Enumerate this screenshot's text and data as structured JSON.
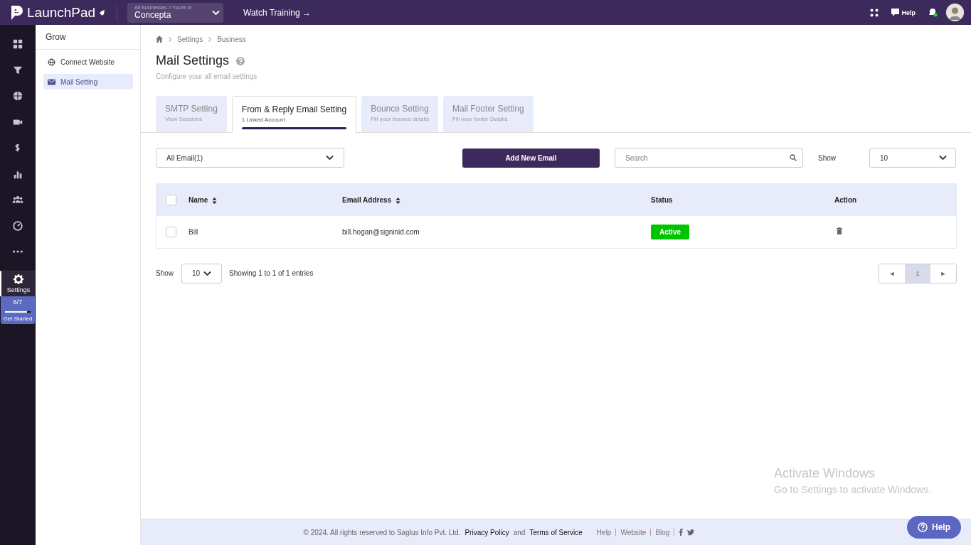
{
  "topbar": {
    "logo": "LaunchPad",
    "business_switcher": {
      "caption": "All Businesses > You're In",
      "value": "Concepta"
    },
    "watch_training": "Watch Training →",
    "help": "Help"
  },
  "rail": {
    "items": [
      {
        "kind": "grid",
        "selected": false
      },
      {
        "kind": "funnel",
        "selected": false
      },
      {
        "kind": "globe",
        "selected": false
      },
      {
        "kind": "video",
        "selected": false
      },
      {
        "kind": "dollar",
        "selected": false
      },
      {
        "kind": "chart",
        "selected": false
      },
      {
        "kind": "people",
        "selected": false
      },
      {
        "kind": "gauge",
        "selected": false
      },
      {
        "kind": "dots",
        "selected": false
      },
      {
        "kind": "gear",
        "label": "Settings",
        "selected": true
      }
    ],
    "progress": {
      "count": "6/7",
      "level": 0.86,
      "label": "Get Started"
    }
  },
  "sidebar": {
    "title": "Grow",
    "items": [
      {
        "label": "Connect Website",
        "kind": "globe",
        "selected": false
      },
      {
        "label": "Mail Setting",
        "kind": "mail",
        "selected": true
      }
    ]
  },
  "breadcrumb": [
    "Settings",
    "Business"
  ],
  "page": {
    "title": "Mail Settings",
    "subtitle": "Configure your all email settings"
  },
  "tabs": [
    {
      "label": "SMTP Setting",
      "sub": "View Sessions",
      "selected": false
    },
    {
      "label": "From & Reply Email Setting",
      "sub": "1 Linked Account",
      "selected": true
    },
    {
      "label": "Bounce Setting",
      "sub": "Fill your bounce details",
      "selected": false
    },
    {
      "label": "Mail Footer Setting",
      "sub": "Fill your footer Details",
      "selected": false
    }
  ],
  "toolbar": {
    "filter": "All Email(1)",
    "add_button": "Add New Email",
    "search_placeholder": "Search",
    "show_label": "Show",
    "show_value": "10"
  },
  "table": {
    "select_all_checked": false,
    "columns": [
      {
        "label": "Name",
        "sortable": true
      },
      {
        "label": "Email Address",
        "sortable": true
      },
      {
        "label": "Status",
        "sortable": false
      },
      {
        "label": "Action",
        "sortable": false
      }
    ],
    "rows": [
      {
        "name": "Bill",
        "email": "bill.hogan@signinid.com",
        "status": "Active",
        "checked": false
      }
    ]
  },
  "pager": {
    "show_label": "Show",
    "show_value": "10",
    "summary": "Showing 1 to 1 of 1 entries",
    "prev": "◄",
    "pages": [
      {
        "label": "1",
        "selected": true
      }
    ],
    "next": "►"
  },
  "overlay": {
    "title": "Activate Windows",
    "text": "Go to Settings to activate Windows."
  },
  "footer": {
    "copyright": "©  2024. All rights reserved to Saglus Info Pvt. Ltd.",
    "privacy": "Privacy Policy",
    "and": "and",
    "terms": "Terms of Service",
    "links": [
      "Help",
      "Website",
      "Blog"
    ]
  },
  "help_button": "Help"
}
